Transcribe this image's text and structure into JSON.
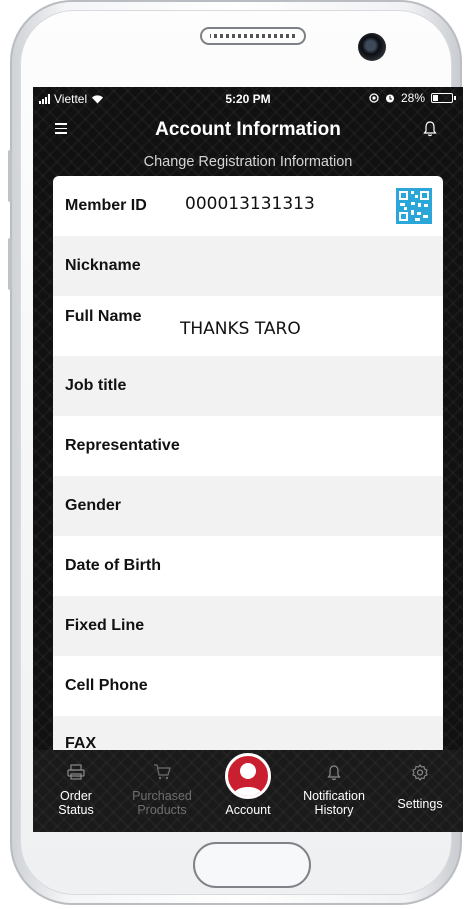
{
  "status_bar": {
    "carrier": "Viettel",
    "time": "5:20 PM",
    "battery": "28%",
    "battery_level": 0.28
  },
  "header": {
    "title": "Account Information"
  },
  "subtitle": "Change Registration Information",
  "rows": [
    {
      "label": "Member ID",
      "value": "000013131313"
    },
    {
      "label": "Nickname",
      "value": ""
    },
    {
      "label": "Full Name",
      "value": "THANKS TARO"
    },
    {
      "label": "Job title",
      "value": ""
    },
    {
      "label": "Representative",
      "value": ""
    },
    {
      "label": "Gender",
      "value": ""
    },
    {
      "label": "Date of Birth",
      "value": ""
    },
    {
      "label": "Fixed Line",
      "value": ""
    },
    {
      "label": "Cell Phone",
      "value": ""
    },
    {
      "label": "FAX",
      "value": ""
    }
  ],
  "tabbar": {
    "order_status": "Order\nStatus",
    "purchased_products": "Purchased\nProducts",
    "account": "Account",
    "notification_history": "Notification\nHistory",
    "settings": "Settings"
  },
  "colors": {
    "accent": "#c91f2e",
    "background": "#111111",
    "row_alt": "#f2f2f2"
  }
}
